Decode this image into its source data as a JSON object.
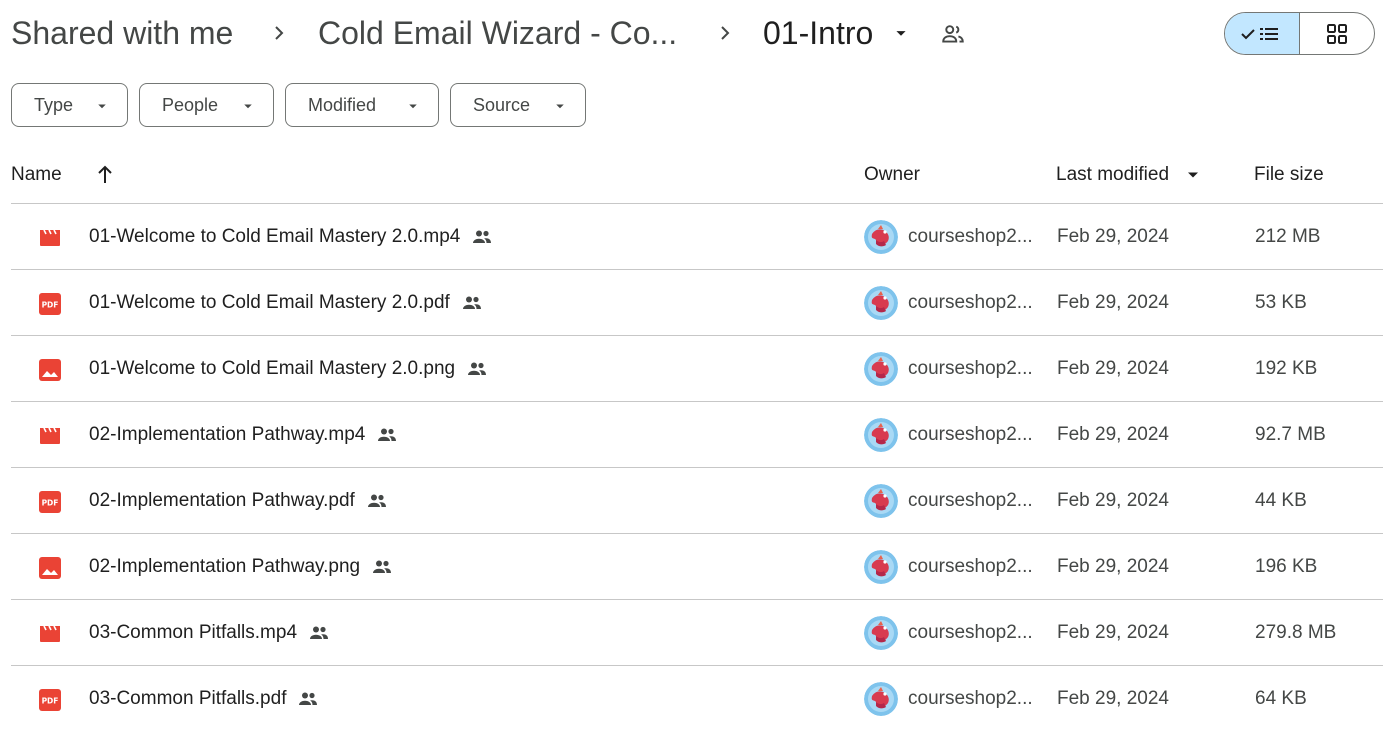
{
  "breadcrumb": {
    "items": [
      "Shared with me",
      "Cold Email Wizard - Co...",
      "01-Intro"
    ]
  },
  "filters": [
    {
      "label": "Type"
    },
    {
      "label": "People"
    },
    {
      "label": "Modified"
    },
    {
      "label": "Source"
    }
  ],
  "columns": {
    "name": "Name",
    "owner": "Owner",
    "last_modified": "Last modified",
    "file_size": "File size"
  },
  "colors": {
    "accent_toggle": "#c2e7ff",
    "file_icon_red": "#ea4335",
    "border": "#747775"
  },
  "files": [
    {
      "name": "01-Welcome to Cold Email Mastery 2.0.mp4",
      "type": "video",
      "icon": "video-file-icon",
      "owner": "courseshop2...",
      "modified": "Feb 29, 2024",
      "size": "212 MB"
    },
    {
      "name": "01-Welcome to Cold Email Mastery 2.0.pdf",
      "type": "pdf",
      "icon": "pdf-file-icon",
      "owner": "courseshop2...",
      "modified": "Feb 29, 2024",
      "size": "53 KB"
    },
    {
      "name": "01-Welcome to Cold Email Mastery 2.0.png",
      "type": "image",
      "icon": "image-file-icon",
      "owner": "courseshop2...",
      "modified": "Feb 29, 2024",
      "size": "192 KB"
    },
    {
      "name": "02-Implementation Pathway.mp4",
      "type": "video",
      "icon": "video-file-icon",
      "owner": "courseshop2...",
      "modified": "Feb 29, 2024",
      "size": "92.7 MB"
    },
    {
      "name": "02-Implementation Pathway.pdf",
      "type": "pdf",
      "icon": "pdf-file-icon",
      "owner": "courseshop2...",
      "modified": "Feb 29, 2024",
      "size": "44 KB"
    },
    {
      "name": "02-Implementation Pathway.png",
      "type": "image",
      "icon": "image-file-icon",
      "owner": "courseshop2...",
      "modified": "Feb 29, 2024",
      "size": "196 KB"
    },
    {
      "name": "03-Common Pitfalls.mp4",
      "type": "video",
      "icon": "video-file-icon",
      "owner": "courseshop2...",
      "modified": "Feb 29, 2024",
      "size": "279.8 MB"
    },
    {
      "name": "03-Common Pitfalls.pdf",
      "type": "pdf",
      "icon": "pdf-file-icon",
      "owner": "courseshop2...",
      "modified": "Feb 29, 2024",
      "size": "64 KB"
    }
  ]
}
